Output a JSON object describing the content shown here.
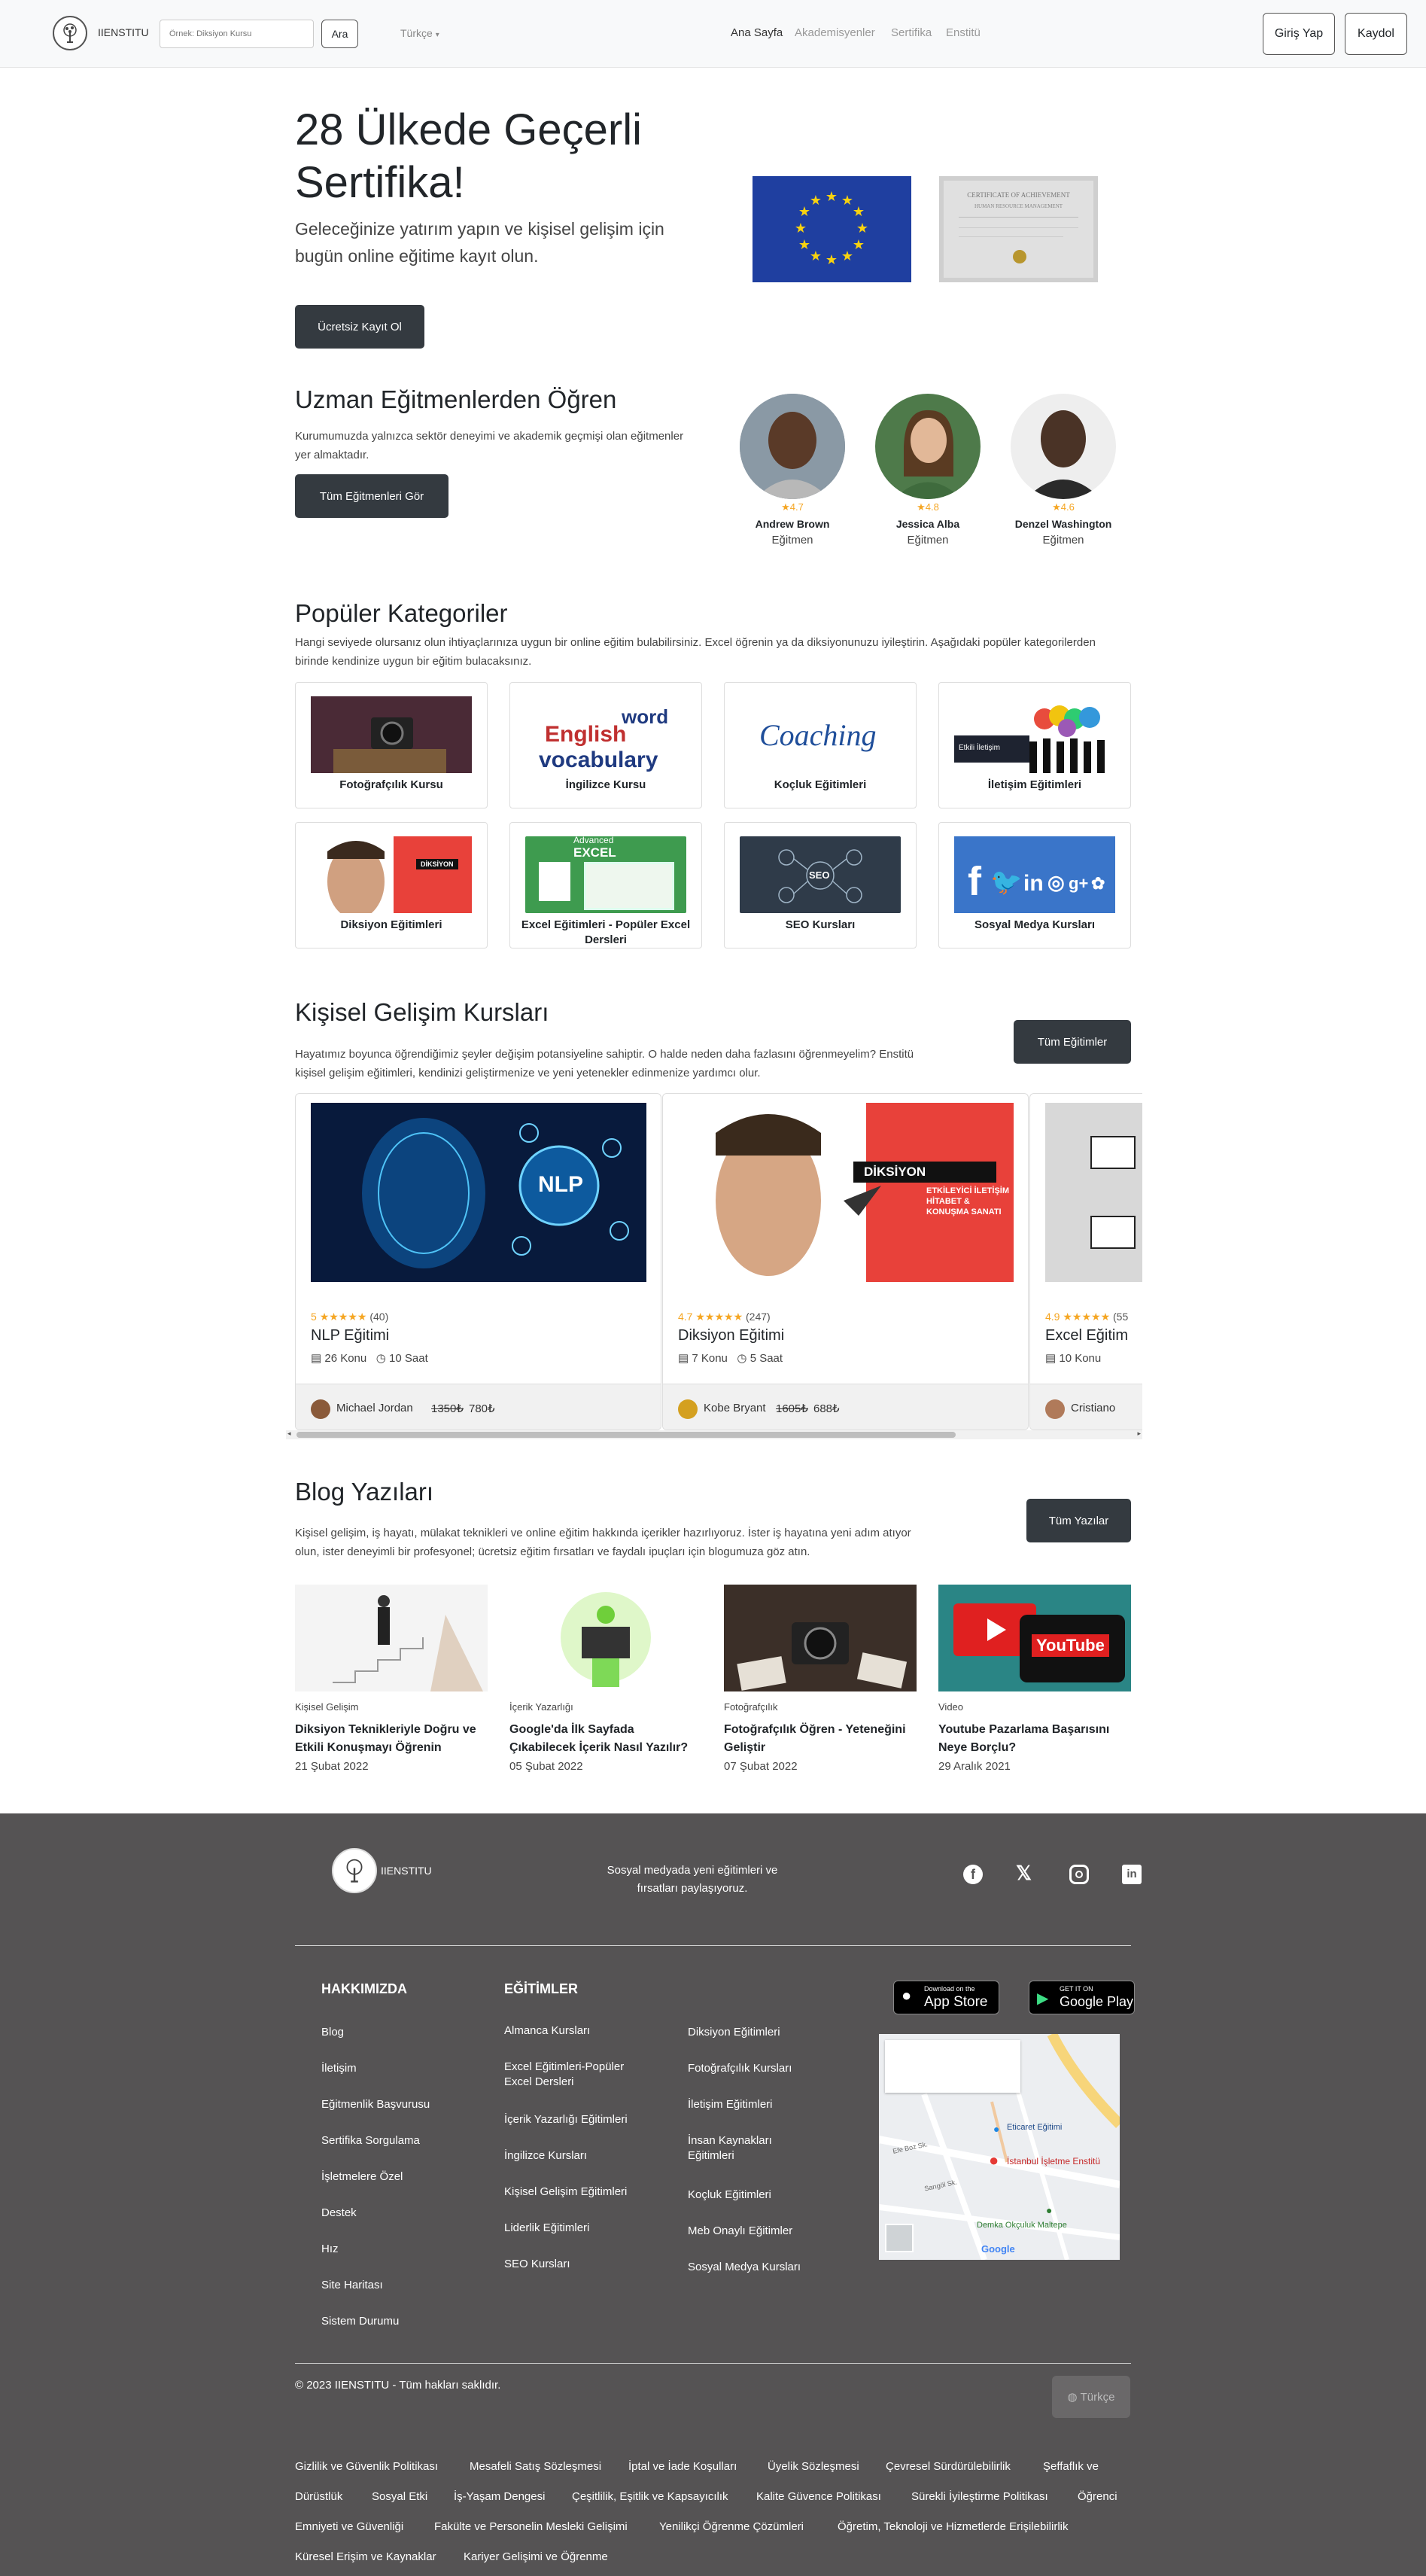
{
  "nav": {
    "brand": "IIENSTITU",
    "search_placeholder": "Örnek: Diksiyon Kursu",
    "search_button": "Ara",
    "language": "Türkçe",
    "links": [
      "Ana Sayfa",
      "Akademisyenler",
      "Sertifika",
      "Enstitü"
    ],
    "login": "Giriş Yap",
    "register": "Kaydol"
  },
  "hero": {
    "title": "28 Ülkede Geçerli Sertifika!",
    "subtitle": "Geleceğinize yatırım yapın ve kişisel gelişim için bugün online eğitime kayıt olun.",
    "cta": "Ücretsiz Kayıt Ol",
    "certificate_text": "CERTIFICATE OF ACHIEVEMENT",
    "certificate_sub": "HUMAN RESOURCE MANAGEMENT"
  },
  "instructors": {
    "title": "Uzman Eğitmenlerden Öğren",
    "desc": "Kurumumuzda yalnızca sektör deneyimi ve akademik geçmişi olan eğitmenler yer almaktadır.",
    "cta": "Tüm Eğitmenleri Gör",
    "people": [
      {
        "rating": "★4.7",
        "name": "Andrew Brown",
        "role": "Eğitmen"
      },
      {
        "rating": "★4.8",
        "name": "Jessica Alba",
        "role": "Eğitmen"
      },
      {
        "rating": "★4.6",
        "name": "Denzel Washington",
        "role": "Eğitmen"
      }
    ]
  },
  "categories": {
    "title": "Popüler Kategoriler",
    "desc": "Hangi seviyede olursanız olun ihtiyaçlarınıza uygun bir online eğitim bulabilirsiniz. Excel öğrenin ya da diksiyonunuzu iyileştirin. Aşağıdaki popüler kategorilerden birinde kendinize uygun bir eğitim bulacaksınız.",
    "items": [
      "Fotoğrafçılık Kursu",
      "İngilizce Kursu",
      "Koçluk Eğitimleri",
      "İletişim Eğitimleri",
      "Diksiyon Eğitimleri",
      "Excel Eğitimleri - Popüler Excel Dersleri",
      "SEO Kursları",
      "Sosyal Medya Kursları"
    ],
    "img_text": {
      "english_word": "word",
      "english_big": "English",
      "english_vocab": "vocabulary",
      "coaching": "Coaching",
      "iletisim": "Etkili İletişim",
      "diksiyon": "DİKSİYON",
      "excel_top": "Advanced",
      "excel": "EXCEL",
      "seo": "SEO"
    }
  },
  "courses": {
    "title": "Kişisel Gelişim Kursları",
    "desc": "Hayatımız boyunca öğrendiğimiz şeyler değişim potansiyeline sahiptir. O halde neden daha fazlasını öğrenmeyelim? Enstitü kişisel gelişim eğitimleri, kendinizi geliştirmenize ve yeni yetenekler edinmenize yardımcı olur.",
    "cta": "Tüm Eğitimler",
    "items": [
      {
        "score": "5",
        "stars": "★★★★★",
        "count": "(40)",
        "title": "NLP Eğitimi",
        "topics": "26 Konu",
        "hours": "10 Saat",
        "instructor": "Michael Jordan",
        "old_price": "1350₺",
        "price": "780₺",
        "img_text": "NLP"
      },
      {
        "score": "4.7",
        "stars": "★★★★★",
        "count": "(247)",
        "title": "Diksiyon Eğitimi",
        "topics": "7 Konu",
        "hours": "5 Saat",
        "instructor": "Kobe Bryant",
        "old_price": "1605₺",
        "price": "688₺",
        "img_text": "DİKSİYON",
        "img_sub": "ETKİLEYİCİ İLETİŞİM HİTABET & KONUŞMA SANATI"
      },
      {
        "score": "4.9",
        "stars": "★★★★★",
        "count": "(55",
        "title": "Excel Eğitim",
        "topics": "10 Konu",
        "hours": "",
        "instructor": "Cristiano",
        "old_price": "",
        "price": ""
      }
    ]
  },
  "blog": {
    "title": "Blog Yazıları",
    "desc": "Kişisel gelişim, iş hayatı, mülakat teknikleri ve online eğitim hakkında içerikler hazırlıyoruz. İster iş hayatına yeni adım atıyor olun, ister deneyimli bir profesyonel; ücretsiz eğitim fırsatları ve faydalı ipuçları için blogumuza göz atın.",
    "cta": "Tüm Yazılar",
    "posts": [
      {
        "category": "Kişisel Gelişim",
        "title": "Diksiyon Teknikleriyle Doğru ve Etkili Konuşmayı Öğrenin",
        "date": "21 Şubat 2022"
      },
      {
        "category": "İçerik Yazarlığı",
        "title": "Google'da İlk Sayfada Çıkabilecek İçerik Nasıl Yazılır?",
        "date": "05 Şubat 2022"
      },
      {
        "category": "Fotoğrafçılık",
        "title": "Fotoğrafçılık Öğren - Yeteneğini Geliştir",
        "date": "07 Şubat 2022"
      },
      {
        "category": "Video",
        "title": "Youtube Pazarlama Başarısını Neye Borçlu?",
        "date": "29 Aralık 2021"
      }
    ],
    "youtube_text": "YouTube"
  },
  "footer": {
    "brand": "IIENSTITU",
    "social_text": "Sosyal medyada yeni eğitimleri ve fırsatları paylaşıyoruz.",
    "about_head": "HAKKIMIZDA",
    "about": [
      "Blog",
      "İletişim",
      "Eğitmenlik Başvurusu",
      "Sertifika Sorgulama",
      "İşletmelere Özel",
      "Destek",
      "Hız",
      "Site Haritası",
      "Sistem Durumu"
    ],
    "edu_head": "EĞİTİMLER",
    "edu_col1": [
      "Almanca Kursları",
      "Excel Eğitimleri-Popüler Excel Dersleri",
      "İçerik Yazarlığı Eğitimleri",
      "İngilizce Kursları",
      "Kişisel Gelişim Eğitimleri",
      "Liderlik Eğitimleri",
      "SEO Kursları"
    ],
    "edu_col2": [
      "Diksiyon Eğitimleri",
      "Fotoğrafçılık Kursları",
      "İletişim Eğitimleri",
      "İnsan Kaynakları Eğitimleri",
      "Koçluk Eğitimleri",
      "Meb Onaylı Eğitimler",
      "Sosyal Medya Kursları"
    ],
    "appstore_small": "Download on the",
    "appstore_big": "App Store",
    "gplay_small": "GET IT ON",
    "gplay_big": "Google Play",
    "map": {
      "label1": "Eticaret Eğitimi",
      "label2": "İstanbul İşletme Enstitü",
      "label3": "Demka Okçuluk Maltepe",
      "street1": "Efe Boz Sk.",
      "street2": "Sarıgöl Sk.",
      "google": "Google"
    },
    "copyright": "© 2023 IIENSTITU - Tüm hakları saklıdır.",
    "lang_button": "Türkçe",
    "legal": [
      "Gizlilik ve Güvenlik Politikası",
      "Mesafeli Satış Sözleşmesi",
      "İptal ve İade Koşulları",
      "Üyelik Sözleşmesi",
      "Çevresel Sürdürülebilirlik",
      "Şeffaflık ve",
      "Dürüstlük",
      "Sosyal Etki",
      "İş-Yaşam Dengesi",
      "Çeşitlilik, Eşitlik ve Kapsayıcılık",
      "Kalite Güvence Politikası",
      "Sürekli İyileştirme Politikası",
      "Öğrenci",
      "Emniyeti ve Güvenliği",
      "Fakülte ve Personelin Mesleki Gelişimi",
      "Yenilikçi Öğrenme Çözümleri",
      "Öğretim, Teknoloji ve Hizmetlerde Erişilebilirlik",
      "Küresel Erişim ve Kaynaklar",
      "Kariyer Gelişimi ve Öğrenme"
    ]
  }
}
